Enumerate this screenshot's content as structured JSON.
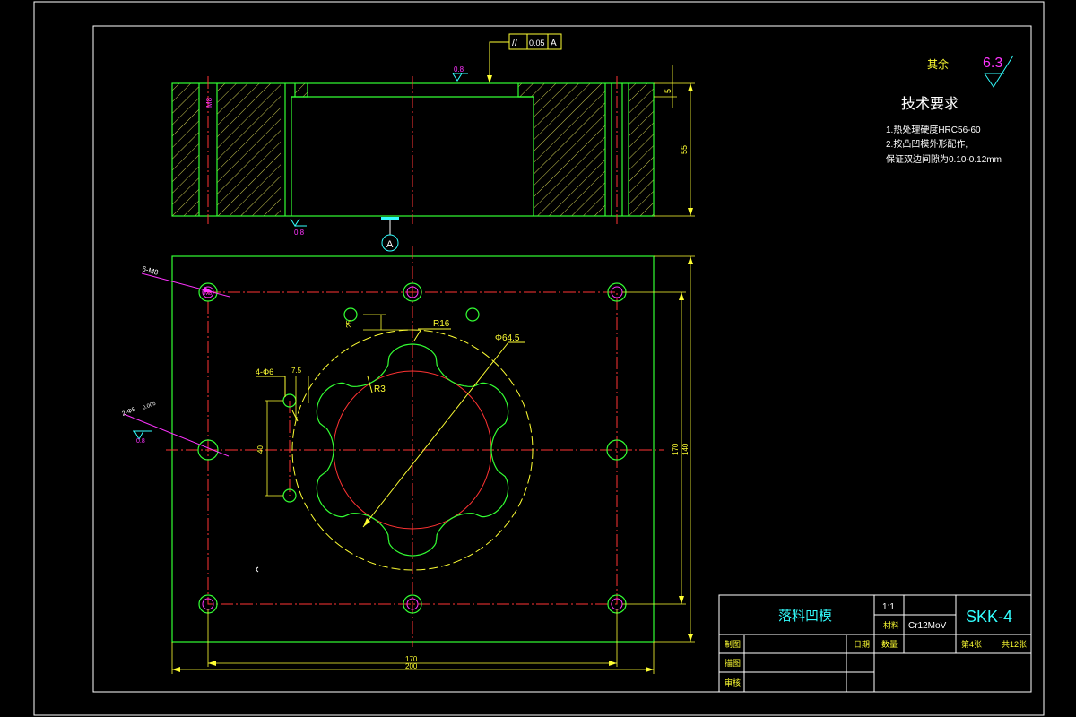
{
  "roughness_general": {
    "prefix": "其余",
    "value": "6.3"
  },
  "tech_requirements": {
    "title": "技术要求",
    "lines": [
      "1.热处理硬度HRC56-60",
      "2.按凸凹模外形配作,",
      "保证双边间隙为0.10-0.12mm"
    ]
  },
  "tolerance_frame": {
    "symbol": "//",
    "value": "0.05",
    "datum": "A"
  },
  "datum_label": "A",
  "section_view": {
    "roughness_top": "0.8",
    "roughness_bottom": "0.8",
    "dim_height": "55",
    "dim_step": "5",
    "thread_label": "M8"
  },
  "plan_view": {
    "label_holes_m8": "6-M8",
    "label_pins": "4-Φ6",
    "label_pins_tol": "2-Φ8",
    "label_pins_tol2": "0.005",
    "label_roughness": "0.8",
    "dim_r16": "R16",
    "dim_r3": "R3",
    "dim_dia": "Φ64.5",
    "dim_25": "25",
    "dim_75": "7.5",
    "dim_40": "40",
    "dim_170_h": "170",
    "dim_200_h": "200",
    "dim_170_v": "170",
    "dim_140_v": "140",
    "hole_label": "M8"
  },
  "title_block": {
    "part_name": "落料凹模",
    "scale": "1:1",
    "material_label": "材料",
    "material": "Cr12MoV",
    "drawing_no": "SKK-4",
    "row_draw": "制图",
    "row_date": "日期",
    "row_qty": "数量",
    "row_sheet": "第4张",
    "row_total": "共12张",
    "row_design": "描图",
    "row_review": "审核"
  }
}
